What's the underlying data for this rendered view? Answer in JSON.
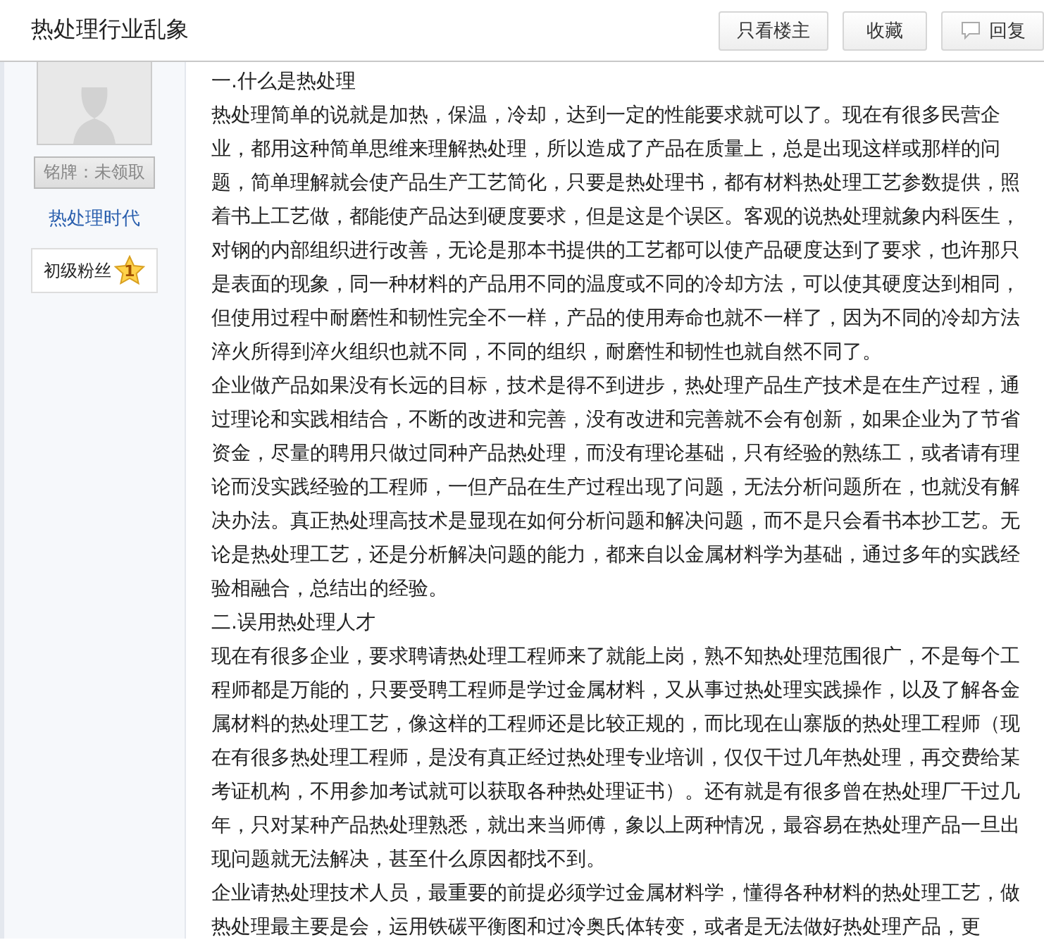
{
  "header": {
    "title": "热处理行业乱象",
    "buttons": [
      {
        "label": "只看楼主",
        "kind": "plain"
      },
      {
        "label": "收藏",
        "kind": "plain"
      },
      {
        "label": "回复",
        "kind": "reply"
      }
    ]
  },
  "author": {
    "medal": "铭牌：未领取",
    "name": "热处理时代",
    "rank": "初级粉丝",
    "rank_badge": "1"
  },
  "post": {
    "paragraphs": [
      "一.什么是热处理",
      "热处理简单的说就是加热，保温，冷却，达到一定的性能要求就可以了。现在有很多民营企业，都用这种简单思维来理解热处理，所以造成了产品在质量上，总是出现这样或那样的问题，简单理解就会使产品生产工艺简化，只要是热处理书，都有材料热处理工艺参数提供，照着书上工艺做，都能使产品达到硬度要求，但是这是个误区。客观的说热处理就象内科医生，对钢的内部组织进行改善，无论是那本书提供的工艺都可以使产品硬度达到了要求，也许那只是表面的现象，同一种材料的产品用不同的温度或不同的冷却方法，可以使其硬度达到相同，但使用过程中耐磨性和韧性完全不一样，产品的使用寿命也就不一样了，因为不同的冷却方法淬火所得到淬火组织也就不同，不同的组织，耐磨性和韧性也就自然不同了。",
      "企业做产品如果没有长远的目标，技术是得不到进步，热处理产品生产技术是在生产过程，通过理论和实践相结合，不断的改进和完善，没有改进和完善就不会有创新，如果企业为了节省资金，尽量的聘用只做过同种产品热处理，而没有理论基础，只有经验的熟练工，或者请有理论而没实践经验的工程师，一但产品在生产过程出现了问题，无法分析问题所在，也就没有解决办法。真正热处理高技术是显现在如何分析问题和解决问题，而不是只会看书本抄工艺。无论是热处理工艺，还是分析解决问题的能力，都来自以金属材料学为基础，通过多年的实践经验相融合，总结出的经验。",
      "二.误用热处理人才",
      "现在有很多企业，要求聘请热处理工程师来了就能上岗，熟不知热处理范围很广，不是每个工程师都是万能的，只要受聘工程师是学过金属材料，又从事过热处理实践操作，以及了解各金属材料的热处理工艺，像这样的工程师还是比较正规的，而比现在山寨版的热处理工程师（现在有很多热处理工程师，是没有真正经过热处理专业培训，仅仅干过几年热处理，再交费给某考证机构，不用参加考试就可以获取各种热处理证书）。还有就是有很多曾在热处理厂干过几年，只对某种产品热处理熟悉，就出来当师傅，象以上两种情况，最容易在热处理产品一旦出现问题就无法解决，甚至什么原因都找不到。",
      "企业请热处理技术人员，最重要的前提必须学过金属材料学，懂得各种材料的热处理工艺，做热处理最主要是会，运用铁碳平衡图和过冷奥氏体转变，或者是无法做好热处理产品，更"
    ]
  }
}
